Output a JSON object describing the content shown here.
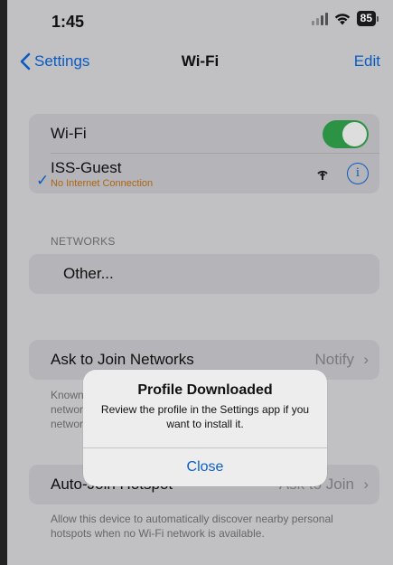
{
  "status_bar": {
    "time": "1:45",
    "battery": "85",
    "icons": [
      "signal-icon",
      "wifi-icon",
      "battery-icon"
    ]
  },
  "nav": {
    "back_label": "Settings",
    "title": "Wi-Fi",
    "edit_label": "Edit"
  },
  "wifi_group": {
    "wifi_label": "Wi-Fi",
    "wifi_enabled": true,
    "connected_network": {
      "name": "ISS-Guest",
      "status": "No Internet Connection",
      "info_glyph": "i"
    }
  },
  "networks": {
    "header": "NETWORKS",
    "other_label": "Other..."
  },
  "ask_to_join": {
    "label": "Ask to Join Networks",
    "value": "Notify",
    "description": "Known networks will be joined automatically. If no known networks are available, you will be notified of available networks."
  },
  "auto_join": {
    "label": "Auto-Join Hotspot",
    "value": "Ask to Join",
    "description": "Allow this device to automatically discover nearby personal hotspots when no Wi-Fi network is available."
  },
  "alert": {
    "title": "Profile Downloaded",
    "message": "Review the profile in the Settings app if you want to install it.",
    "button": "Close"
  },
  "colors": {
    "accent": "#0a5fc9",
    "toggle_on": "#2e9a47",
    "warning": "#b36a15"
  }
}
